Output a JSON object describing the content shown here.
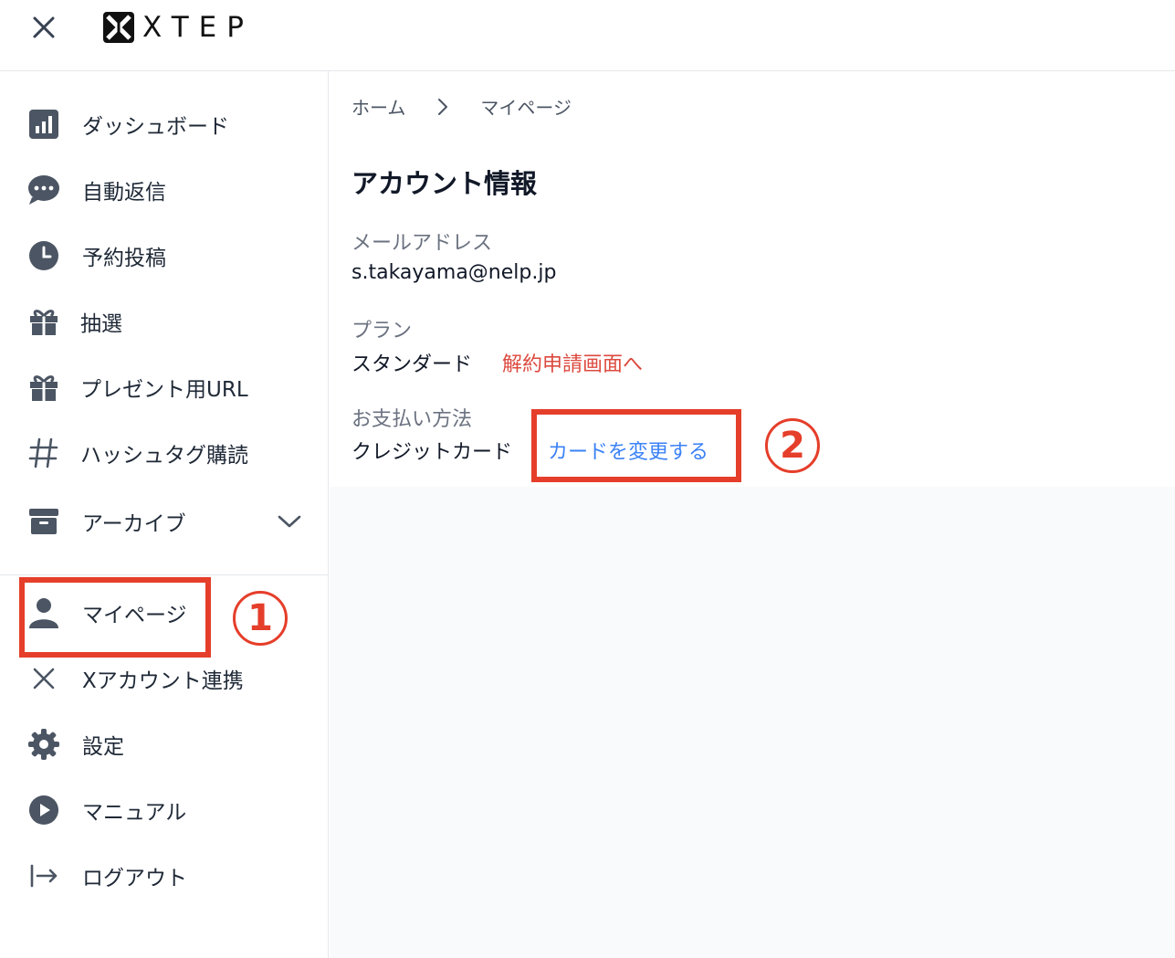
{
  "header": {
    "logo_text": "XTEP",
    "close_icon": "close-icon"
  },
  "sidebar": {
    "items": [
      {
        "label": "ダッシュボード",
        "icon": "chart-bar-icon"
      },
      {
        "label": "自動返信",
        "icon": "chat-bubble-icon"
      },
      {
        "label": "予約投稿",
        "icon": "clock-icon"
      },
      {
        "label": "抽選",
        "icon": "gift-icon"
      },
      {
        "label": "プレゼント用URL",
        "icon": "gift-icon"
      },
      {
        "label": "ハッシュタグ購読",
        "icon": "hashtag-icon"
      },
      {
        "label": "アーカイブ",
        "icon": "archive-box-icon"
      }
    ],
    "bottom_items": [
      {
        "label": "マイページ",
        "icon": "user-icon"
      },
      {
        "label": "Xアカウント連携",
        "icon": "x-logo-icon"
      },
      {
        "label": "設定",
        "icon": "gear-icon"
      },
      {
        "label": "マニュアル",
        "icon": "play-circle-icon"
      },
      {
        "label": "ログアウト",
        "icon": "logout-arrow-icon"
      }
    ]
  },
  "breadcrumb": {
    "home": "ホーム",
    "current": "マイページ"
  },
  "account": {
    "title": "アカウント情報",
    "email_label": "メールアドレス",
    "email_value": "s.takayama@nelp.jp",
    "plan_label": "プラン",
    "plan_value": "スタンダード",
    "cancel_link": "解約申請画面へ",
    "payment_label": "お支払い方法",
    "payment_value": "クレジットカード",
    "change_card_link": "カードを変更する"
  },
  "annotations": {
    "step1": "1",
    "step2": "2",
    "color": "#e53e2a"
  }
}
